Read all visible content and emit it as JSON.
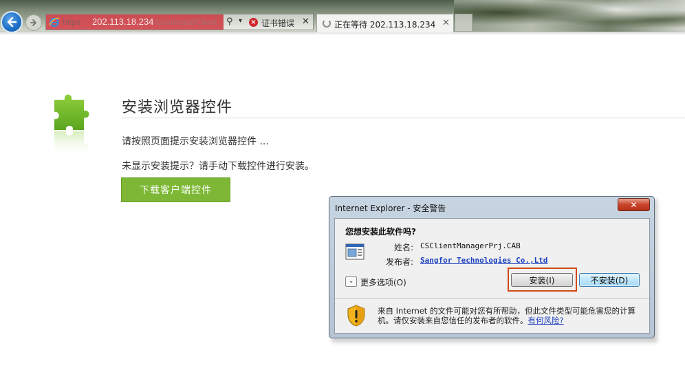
{
  "browser": {
    "address": {
      "protocol": "https",
      "host": "202.113.18.234",
      "rest": "/com/installClient",
      "cert_error": "证书错误"
    },
    "tab": {
      "label": "正在等待 202.113.18.234"
    }
  },
  "page": {
    "heading": "安装浏览器控件",
    "prompt1": "请按照页面提示安装浏览器控件 ...",
    "prompt2": "未显示安装提示？请手动下载控件进行安装。",
    "download_label": "下载客户端控件",
    "accent": "#7db735"
  },
  "dialog": {
    "title": "Internet Explorer - 安全警告",
    "close_label": "✕",
    "question": "您想安装此软件吗?",
    "name_label": "姓名:",
    "name_value": "CSClientManagerPrj.CAB",
    "publisher_label": "发布者:",
    "publisher_value": "Sangfor Technologies Co.,Ltd",
    "more_options": "更多选项(O)",
    "install_label": "安装(I)",
    "noinstall_label": "不安装(D)",
    "warning_text": "来自 Internet 的文件可能对您有所帮助，但此文件类型可能危害您的计算机。请仅安装来自您信任的发布者的软件。",
    "risk_link": "有何风险?"
  }
}
